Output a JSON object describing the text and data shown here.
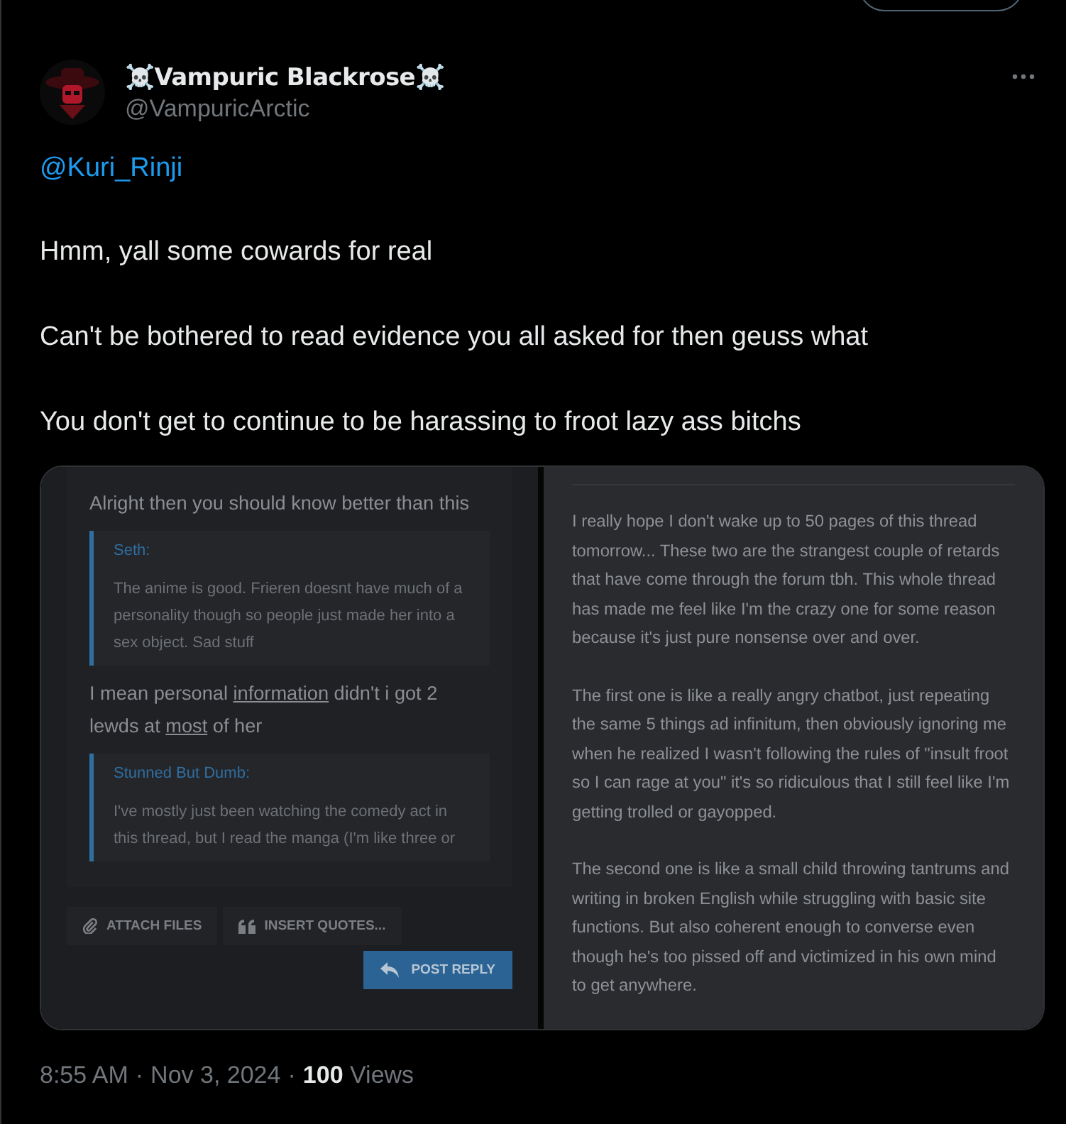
{
  "tweet": {
    "author": {
      "name": "☠️Vampuric Blackrose☠️",
      "handle": "@VampuricArctic"
    },
    "mention": "@Kuri_Rinji",
    "paragraphs": [
      "Hmm, yall some cowards for real",
      "Can't be bothered to read evidence you all asked for then geuss what",
      "You don't get to continue to be harassing to froot lazy ass bitchs"
    ],
    "media": {
      "left_panel": {
        "blocks": [
          {
            "kind": "text",
            "segments": [
              {
                "text": "Alright then you should know better than this",
                "underlined": false
              }
            ]
          },
          {
            "kind": "quote",
            "author": "Seth:",
            "text": "The anime is good. Frieren doesnt have much of a personality though so people just made her into a sex object. Sad stuff"
          },
          {
            "kind": "text",
            "segments": [
              {
                "text": "I mean personal ",
                "underlined": false
              },
              {
                "text": "information",
                "underlined": true
              },
              {
                "text": " didn't i got 2 lewds at ",
                "underlined": false
              },
              {
                "text": "most",
                "underlined": true
              },
              {
                "text": " of her",
                "underlined": false
              }
            ]
          },
          {
            "kind": "quote",
            "author": "Stunned But Dumb:",
            "text": "I've mostly just been watching the comedy act in this thread, but I read the manga (I'm like three or"
          }
        ],
        "buttons": [
          "ATTACH FILES",
          "INSERT QUOTES..."
        ],
        "submit": "POST REPLY"
      },
      "right_panel": {
        "paragraphs": [
          "I really hope I don't wake up to 50 pages of this thread tomorrow... These two are the strangest couple of retards that have come through the forum tbh. This whole thread has made me feel like I'm the crazy one for some reason because it's just pure nonsense over and over.",
          "The first one is like a really angry chatbot, just repeating the same 5 things ad infinitum, then obviously ignoring me when he realized I wasn't following the rules of \"insult froot so I can rage at you\" it's so ridiculous that I still feel like I'm getting trolled or gayopped.",
          "The second one is like a small child throwing tantrums and writing in broken English while struggling with basic site functions. But also coherent enough to converse even though he's too pissed off and victimized in his own mind to get anywhere."
        ]
      }
    },
    "footer": {
      "separator": "·",
      "time": "8:55 AM",
      "date": "Nov 3, 2024",
      "views_count": "100",
      "views_label": "Views"
    }
  }
}
